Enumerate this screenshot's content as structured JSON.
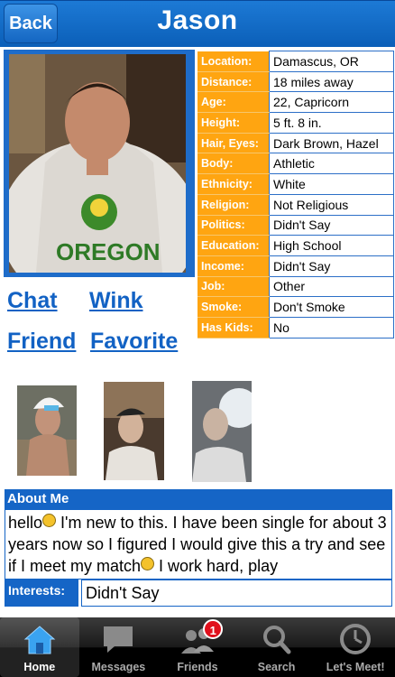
{
  "header": {
    "back_label": "Back",
    "title": "Jason"
  },
  "details": [
    {
      "label": "Location:",
      "value": "Damascus, OR"
    },
    {
      "label": "Distance:",
      "value": "18 miles away"
    },
    {
      "label": "Age:",
      "value": "22, Capricorn"
    },
    {
      "label": "Height:",
      "value": "5 ft. 8 in."
    },
    {
      "label": "Hair, Eyes:",
      "value": "Dark Brown, Hazel"
    },
    {
      "label": "Body:",
      "value": "Athletic"
    },
    {
      "label": "Ethnicity:",
      "value": "White"
    },
    {
      "label": "Religion:",
      "value": "Not Religious"
    },
    {
      "label": "Politics:",
      "value": "Didn't Say"
    },
    {
      "label": "Education:",
      "value": "High School"
    },
    {
      "label": "Income:",
      "value": "Didn't Say"
    },
    {
      "label": "Job:",
      "value": "Other"
    },
    {
      "label": "Smoke:",
      "value": "Don't Smoke"
    },
    {
      "label": "Has Kids:",
      "value": "No"
    }
  ],
  "actions": {
    "chat": "Chat",
    "wink": "Wink",
    "friend": "Friend",
    "favorite": "Favorite"
  },
  "about": {
    "heading": "About Me",
    "text_1": "hello",
    "text_2": " I'm new to this. I have been single for about 3 years now so I figured I would give this a try and see if I meet my match",
    "text_3": " I work hard, play"
  },
  "interests": {
    "label": "Interests:",
    "value": "Didn't Say"
  },
  "tabbar": {
    "home": "Home",
    "messages": "Messages",
    "friends": "Friends",
    "friends_badge": "1",
    "search": "Search",
    "lets_meet": "Let's Meet!"
  },
  "colors": {
    "header_blue": "#1565c6",
    "label_orange": "#ffa511",
    "link_blue": "#1262c4",
    "badge_red": "#e0101c"
  }
}
